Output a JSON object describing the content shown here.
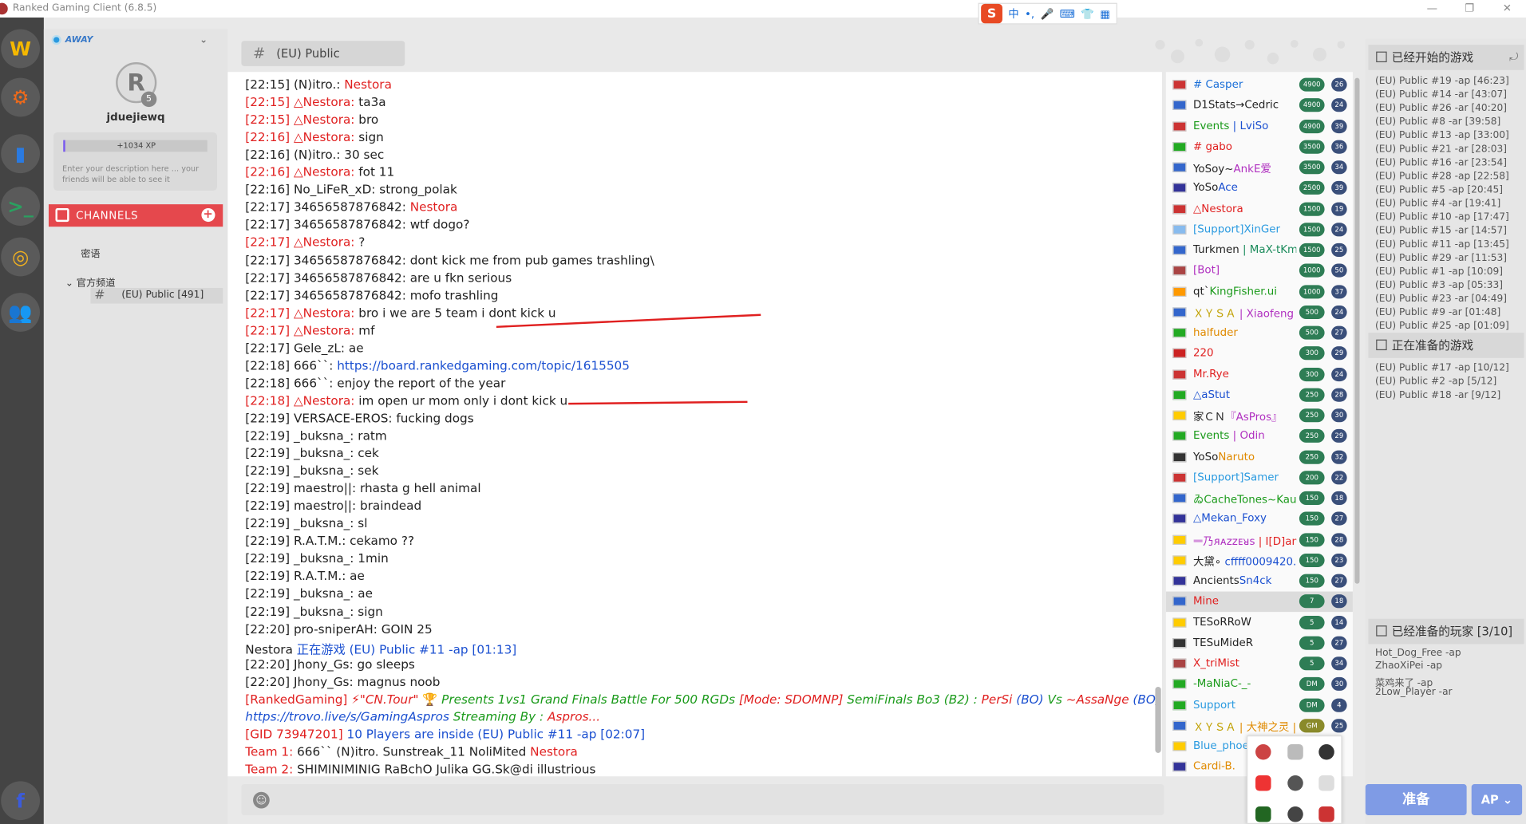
{
  "window": {
    "title": "Ranked Gaming Client (6.8.5)",
    "controls": [
      "—",
      "❐",
      "✕"
    ]
  },
  "ime": {
    "logo": "S",
    "items": [
      "中",
      "•,",
      "🎤",
      "⌨",
      "👕",
      "▦"
    ]
  },
  "strip": [
    {
      "name": "warcraft-icon",
      "glyph": "W",
      "color": "#f5b800"
    },
    {
      "name": "settings-icon",
      "glyph": "⚙",
      "color": "#f06a1a"
    },
    {
      "name": "stats-icon",
      "glyph": "▮",
      "color": "#2a7ae0"
    },
    {
      "name": "console-icon",
      "glyph": ">_",
      "color": "#2aa060"
    },
    {
      "name": "coins-icon",
      "glyph": "◎",
      "color": "#f0b020"
    },
    {
      "name": "friends-icon",
      "glyph": "👥",
      "color": "#e5484d"
    },
    {
      "name": "facebook-icon",
      "glyph": "f",
      "color": "#3b5bdb"
    }
  ],
  "profile": {
    "status": "AWAY",
    "username": "jduejiewq",
    "level": "5",
    "xp": "+1034 XP",
    "description": "Enter your description here ... your friends will be able to see it"
  },
  "channels": {
    "header": "CHANNELS",
    "items": [
      "密语",
      "官方频道",
      "(EU) Public [491]"
    ]
  },
  "chat_header": "(EU) Public",
  "messages": [
    {
      "segs": [
        {
          "t": "[22:15] ",
          "c": ""
        },
        {
          "t": "(N)itro.: ",
          "c": "b"
        },
        {
          "t": "Nestora",
          "c": "red"
        }
      ]
    },
    {
      "segs": [
        {
          "t": "[22:15] ",
          "c": "red"
        },
        {
          "t": "△Nestora: ",
          "c": "red b"
        },
        {
          "t": "ta3a",
          "c": ""
        }
      ]
    },
    {
      "segs": [
        {
          "t": "[22:15] ",
          "c": "red"
        },
        {
          "t": "△Nestora: ",
          "c": "red b"
        },
        {
          "t": "bro",
          "c": ""
        }
      ]
    },
    {
      "segs": [
        {
          "t": "[22:16] ",
          "c": "red"
        },
        {
          "t": "△Nestora: ",
          "c": "red b"
        },
        {
          "t": "sign",
          "c": ""
        }
      ]
    },
    {
      "segs": [
        {
          "t": "[22:16] ",
          "c": ""
        },
        {
          "t": "(N)itro.: ",
          "c": "b"
        },
        {
          "t": "30 sec",
          "c": ""
        }
      ]
    },
    {
      "segs": [
        {
          "t": "[22:16] ",
          "c": "red"
        },
        {
          "t": "△Nestora: ",
          "c": "red b"
        },
        {
          "t": "fot 11",
          "c": ""
        }
      ]
    },
    {
      "segs": [
        {
          "t": "[22:16] ",
          "c": ""
        },
        {
          "t": "No_LiFeR_xD: ",
          "c": "b"
        },
        {
          "t": "strong_polak",
          "c": ""
        }
      ]
    },
    {
      "segs": [
        {
          "t": "[22:17] ",
          "c": ""
        },
        {
          "t": "34656587876842: ",
          "c": "b"
        },
        {
          "t": "Nestora",
          "c": "red"
        }
      ]
    },
    {
      "segs": [
        {
          "t": "[22:17] ",
          "c": ""
        },
        {
          "t": "34656587876842: ",
          "c": "b"
        },
        {
          "t": "wtf dogo?",
          "c": ""
        }
      ]
    },
    {
      "segs": [
        {
          "t": "[22:17] ",
          "c": "red"
        },
        {
          "t": "△Nestora: ",
          "c": "red b"
        },
        {
          "t": "?",
          "c": ""
        }
      ]
    },
    {
      "segs": [
        {
          "t": "[22:17] ",
          "c": ""
        },
        {
          "t": "34656587876842: ",
          "c": "b"
        },
        {
          "t": "dont kick me from pub games trashling\\",
          "c": ""
        }
      ]
    },
    {
      "segs": [
        {
          "t": "[22:17] ",
          "c": ""
        },
        {
          "t": "34656587876842: ",
          "c": "b"
        },
        {
          "t": "are u fkn serious",
          "c": ""
        }
      ]
    },
    {
      "segs": [
        {
          "t": "[22:17] ",
          "c": ""
        },
        {
          "t": "34656587876842: ",
          "c": "b"
        },
        {
          "t": "mofo trashling",
          "c": ""
        }
      ]
    },
    {
      "segs": [
        {
          "t": "[22:17] ",
          "c": "red"
        },
        {
          "t": "△Nestora: ",
          "c": "red b"
        },
        {
          "t": "bro i we are 5 team i dont kick u",
          "c": ""
        }
      ]
    },
    {
      "segs": [
        {
          "t": "[22:17] ",
          "c": "red"
        },
        {
          "t": "△Nestora: ",
          "c": "red b"
        },
        {
          "t": "mf",
          "c": ""
        }
      ]
    },
    {
      "segs": [
        {
          "t": "[22:17] ",
          "c": ""
        },
        {
          "t": "Gele_zL: ",
          "c": "b"
        },
        {
          "t": "ae",
          "c": ""
        }
      ]
    },
    {
      "segs": [
        {
          "t": "[22:18] ",
          "c": ""
        },
        {
          "t": "666``: ",
          "c": "b"
        },
        {
          "t": "https://board.rankedgaming.com/topic/1615505",
          "c": "blue"
        }
      ]
    },
    {
      "segs": [
        {
          "t": "[22:18] ",
          "c": ""
        },
        {
          "t": "666``: ",
          "c": "b"
        },
        {
          "t": "enjoy the report of the year",
          "c": ""
        }
      ]
    },
    {
      "segs": [
        {
          "t": "[22:18] ",
          "c": "red"
        },
        {
          "t": "△Nestora: ",
          "c": "red b"
        },
        {
          "t": "im open ur mom only i dont kick u",
          "c": ""
        }
      ]
    },
    {
      "segs": [
        {
          "t": "[22:19] ",
          "c": ""
        },
        {
          "t": "VERSACE-EROS: ",
          "c": "b"
        },
        {
          "t": "fucking dogs",
          "c": ""
        }
      ]
    },
    {
      "segs": [
        {
          "t": "[22:19] ",
          "c": ""
        },
        {
          "t": "_buksna_: ",
          "c": "b"
        },
        {
          "t": "ratm",
          "c": ""
        }
      ]
    },
    {
      "segs": [
        {
          "t": "[22:19] ",
          "c": ""
        },
        {
          "t": "_buksna_: ",
          "c": "b"
        },
        {
          "t": "cek",
          "c": ""
        }
      ]
    },
    {
      "segs": [
        {
          "t": "[22:19] ",
          "c": ""
        },
        {
          "t": "_buksna_: ",
          "c": "b"
        },
        {
          "t": "sek",
          "c": ""
        }
      ]
    },
    {
      "segs": [
        {
          "t": "[22:19] ",
          "c": ""
        },
        {
          "t": "maestro||: ",
          "c": "b"
        },
        {
          "t": "rhasta g hell animal",
          "c": ""
        }
      ]
    },
    {
      "segs": [
        {
          "t": "[22:19] ",
          "c": ""
        },
        {
          "t": "maestro||: ",
          "c": "b"
        },
        {
          "t": "braindead",
          "c": ""
        }
      ]
    },
    {
      "segs": [
        {
          "t": "[22:19] ",
          "c": ""
        },
        {
          "t": "_buksna_: ",
          "c": "b"
        },
        {
          "t": "sl",
          "c": ""
        }
      ]
    },
    {
      "segs": [
        {
          "t": "[22:19] ",
          "c": ""
        },
        {
          "t": "R.A.T.M.: ",
          "c": "b"
        },
        {
          "t": "cekamo ??",
          "c": ""
        }
      ]
    },
    {
      "segs": [
        {
          "t": "[22:19] ",
          "c": ""
        },
        {
          "t": "_buksna_: ",
          "c": "b"
        },
        {
          "t": "1min",
          "c": ""
        }
      ]
    },
    {
      "segs": [
        {
          "t": "[22:19] ",
          "c": ""
        },
        {
          "t": "R.A.T.M.: ",
          "c": "b"
        },
        {
          "t": "ae",
          "c": ""
        }
      ]
    },
    {
      "segs": [
        {
          "t": "[22:19] ",
          "c": ""
        },
        {
          "t": "_buksna_: ",
          "c": "b"
        },
        {
          "t": "ae",
          "c": ""
        }
      ]
    },
    {
      "segs": [
        {
          "t": "[22:19] ",
          "c": ""
        },
        {
          "t": "_buksna_: ",
          "c": "b"
        },
        {
          "t": "sign",
          "c": ""
        }
      ]
    },
    {
      "segs": [
        {
          "t": "[22:20] ",
          "c": ""
        },
        {
          "t": "pro-sniperAH: ",
          "c": "b"
        },
        {
          "t": "GOIN 25",
          "c": ""
        }
      ]
    },
    {
      "segs": [
        {
          "t": "Nestora ",
          "c": "b"
        },
        {
          "t": "正在游戏 (EU) Public #11 -ap [01:13]",
          "c": "blue"
        }
      ]
    },
    {
      "segs": [
        {
          "t": "[22:20] ",
          "c": ""
        },
        {
          "t": "Jhony_Gs: ",
          "c": "b"
        },
        {
          "t": "go sleeps",
          "c": ""
        }
      ]
    },
    {
      "segs": [
        {
          "t": "[22:20] ",
          "c": ""
        },
        {
          "t": "Jhony_Gs: ",
          "c": "b"
        },
        {
          "t": "magnus noob",
          "c": ""
        }
      ]
    },
    {
      "segs": [
        {
          "t": "[RankedGaming] ",
          "c": "red"
        },
        {
          "t": "⚡\"CN.Tour\" ",
          "c": "red ital b"
        },
        {
          "t": "🏆 ",
          "c": "orange"
        },
        {
          "t": "Presents 1vs1 Grand Finals Battle For 500 RGDs ",
          "c": "green ital"
        },
        {
          "t": "[Mode: SDOMNP] ",
          "c": "red ital b"
        },
        {
          "t": "SemiFinals Bo3 (B2) : ",
          "c": "green ital"
        },
        {
          "t": "PerSi ",
          "c": "red ital b"
        },
        {
          "t": "(BO) ",
          "c": "blue ital b"
        },
        {
          "t": "Vs ",
          "c": "green ital b"
        },
        {
          "t": "~AssaNge ",
          "c": "red ital b"
        },
        {
          "t": "(BO)",
          "c": "blue ital b"
        }
      ]
    },
    {
      "segs": [
        {
          "t": "https://trovo.live/s/GamingAspros ",
          "c": "blue ital"
        },
        {
          "t": "Streaming By : ",
          "c": "green ital b"
        },
        {
          "t": "Aspros...",
          "c": "red ital b"
        }
      ]
    },
    {
      "segs": [
        {
          "t": "[GID 73947201] ",
          "c": "red"
        },
        {
          "t": "10 Players are inside (EU) Public #11 -ap [02:07]",
          "c": "blue"
        }
      ]
    },
    {
      "segs": [
        {
          "t": "Team 1:   ",
          "c": "red"
        },
        {
          "t": "666``   (N)itro.   Sunstreak_11   NoliMited   ",
          "c": "b"
        },
        {
          "t": "Nestora",
          "c": "red b"
        }
      ]
    },
    {
      "segs": [
        {
          "t": "Team 2:   ",
          "c": "red"
        },
        {
          "t": "SHIMINIMINIG   RaBchO   Julika   GG.Sk@di   illustrious",
          "c": "b"
        }
      ]
    }
  ],
  "users": [
    {
      "flag": "#c33",
      "segs": [
        {
          "t": "# Casper",
          "c": "#1a6fd8"
        }
      ],
      "elo": "4900",
      "lv": "26"
    },
    {
      "flag": "#36c",
      "segs": [
        {
          "t": "D1Stats→Cedric",
          "c": "#222"
        }
      ],
      "elo": "4900",
      "lv": "24"
    },
    {
      "flag": "#c33",
      "segs": [
        {
          "t": "Events",
          "c": "#1a9a1a"
        },
        {
          "t": " | LviSo",
          "c": "#1a4fd0"
        }
      ],
      "elo": "4900",
      "lv": "39"
    },
    {
      "flag": "#2a2",
      "segs": [
        {
          "t": "# gabo",
          "c": "#e02020"
        }
      ],
      "elo": "3500",
      "lv": "36"
    },
    {
      "flag": "#36c",
      "segs": [
        {
          "t": "YoSoy~",
          "c": "#222"
        },
        {
          "t": "AnkE爱",
          "c": "#b030c0"
        }
      ],
      "elo": "3500",
      "lv": "34"
    },
    {
      "flag": "#339",
      "segs": [
        {
          "t": "YoSo",
          "c": "#222"
        },
        {
          "t": "Ace",
          "c": "#1a4fd0"
        }
      ],
      "elo": "2500",
      "lv": "39"
    },
    {
      "flag": "#c33",
      "segs": [
        {
          "t": "△Nestora",
          "c": "#e02020"
        }
      ],
      "elo": "1500",
      "lv": "19"
    },
    {
      "flag": "#8be",
      "segs": [
        {
          "t": "[Support]XinGer",
          "c": "#2a9ae0"
        }
      ],
      "elo": "1500",
      "lv": "24"
    },
    {
      "flag": "#36c",
      "segs": [
        {
          "t": "Turkmen",
          "c": "#222"
        },
        {
          "t": " | MaX-tKm",
          "c": "#1a8a5a"
        }
      ],
      "elo": "1500",
      "lv": "25"
    },
    {
      "flag": "#a44",
      "segs": [
        {
          "t": "[Bot]",
          "c": "#b030c0"
        }
      ],
      "elo": "1000",
      "lv": "50"
    },
    {
      "flag": "#f90",
      "segs": [
        {
          "t": "qt`",
          "c": "#222"
        },
        {
          "t": "KingFisher.ui",
          "c": "#1a9a1a"
        }
      ],
      "elo": "1000",
      "lv": "37"
    },
    {
      "flag": "#36c",
      "segs": [
        {
          "t": "ＸＹＳＡ",
          "c": "#c0a000"
        },
        {
          "t": " | Xiaofeng | T",
          "c": "#b030c0"
        }
      ],
      "elo": "500",
      "lv": "24"
    },
    {
      "flag": "#2a2",
      "segs": [
        {
          "t": "halfuder",
          "c": "#e08a00"
        }
      ],
      "elo": "500",
      "lv": "27"
    },
    {
      "flag": "#c22",
      "segs": [
        {
          "t": "220",
          "c": "#e02020"
        }
      ],
      "elo": "300",
      "lv": "29"
    },
    {
      "flag": "#c33",
      "segs": [
        {
          "t": "Mr.Rye",
          "c": "#e02020"
        }
      ],
      "elo": "300",
      "lv": "24"
    },
    {
      "flag": "#2a2",
      "segs": [
        {
          "t": "△aStut",
          "c": "#1a4fd0"
        }
      ],
      "elo": "250",
      "lv": "28"
    },
    {
      "flag": "#fc0",
      "segs": [
        {
          "t": "家ＣＮ",
          "c": "#222"
        },
        {
          "t": "『AsPros』",
          "c": "#b030c0"
        }
      ],
      "elo": "250",
      "lv": "30"
    },
    {
      "flag": "#2a2",
      "segs": [
        {
          "t": "Events",
          "c": "#1a9a1a"
        },
        {
          "t": " | Odin",
          "c": "#b030c0"
        }
      ],
      "elo": "250",
      "lv": "29"
    },
    {
      "flag": "#333",
      "segs": [
        {
          "t": "YoSo",
          "c": "#222"
        },
        {
          "t": "Naruto",
          "c": "#e08a00"
        }
      ],
      "elo": "250",
      "lv": "32"
    },
    {
      "flag": "#c33",
      "segs": [
        {
          "t": "[Support]Samer",
          "c": "#2a9ae0"
        }
      ],
      "elo": "200",
      "lv": "22"
    },
    {
      "flag": "#36c",
      "segs": [
        {
          "t": "ゐCacheTones~Kauu»",
          "c": "#1a9a1a"
        }
      ],
      "elo": "150",
      "lv": "18"
    },
    {
      "flag": "#339",
      "segs": [
        {
          "t": "△Mekan_Foxy",
          "c": "#1a4fd0"
        }
      ],
      "elo": "150",
      "lv": "27"
    },
    {
      "flag": "#fc0",
      "segs": [
        {
          "t": "ᆖ乃ᴙᴀzzᴇᴚs",
          "c": "#b030c0"
        },
        {
          "t": " | I[D]anil",
          "c": "#e02020"
        }
      ],
      "elo": "150",
      "lv": "28"
    },
    {
      "flag": "#fc0",
      "segs": [
        {
          "t": "大黛∘",
          "c": "#222"
        },
        {
          "t": " cffff0009420.",
          "c": "#1a4fd0"
        }
      ],
      "elo": "150",
      "lv": "23"
    },
    {
      "flag": "#339",
      "segs": [
        {
          "t": "Ancients",
          "c": "#222"
        },
        {
          "t": "Sn4ck",
          "c": "#1a4fd0"
        }
      ],
      "elo": "150",
      "lv": "27"
    },
    {
      "flag": "#36c",
      "segs": [
        {
          "t": "Mine",
          "c": "#e02020"
        }
      ],
      "elo": "7",
      "lv": "18",
      "sel": true
    },
    {
      "flag": "#fc0",
      "segs": [
        {
          "t": "TESoRRoW",
          "c": "#222"
        }
      ],
      "elo": "5",
      "lv": "14"
    },
    {
      "flag": "#333",
      "segs": [
        {
          "t": "TESuMideR",
          "c": "#222"
        }
      ],
      "elo": "5",
      "lv": "27"
    },
    {
      "flag": "#a44",
      "segs": [
        {
          "t": "X_triMist",
          "c": "#e02020"
        }
      ],
      "elo": "5",
      "lv": "34"
    },
    {
      "flag": "#2a2",
      "segs": [
        {
          "t": "-MaNiaC-_-",
          "c": "#1a9a1a"
        }
      ],
      "elo": "DM",
      "lv": "30"
    },
    {
      "flag": "#2a2",
      "segs": [
        {
          "t": "Support",
          "c": "#2a9ae0"
        }
      ],
      "elo": "DM",
      "lv": "4"
    },
    {
      "flag": "#36c",
      "segs": [
        {
          "t": "ＸＹＳＡ",
          "c": "#c0a000"
        },
        {
          "t": " | 大神之灵 | T",
          "c": "#e08a00"
        }
      ],
      "elo": "GM",
      "lv": "25"
    },
    {
      "flag": "#fc0",
      "segs": [
        {
          "t": "Blue_phoe",
          "c": "#2a9ae0"
        }
      ],
      "elo": "",
      "lv": ""
    },
    {
      "flag": "#339",
      "segs": [
        {
          "t": "Cardi-B.",
          "c": "#e08a00"
        }
      ],
      "elo": "",
      "lv": ""
    }
  ],
  "started_games": {
    "title": "已经开始的游戏",
    "items": [
      "(EU) Public #19 -ap [46:23]",
      "(EU) Public #14 -ar [43:07]",
      "(EU) Public #26 -ar [40:20]",
      "(EU) Public #8 -ar [39:58]",
      "(EU) Public #13 -ap [33:00]",
      "(EU) Public #21 -ar [28:03]",
      "(EU) Public #16 -ar [23:54]",
      "(EU) Public #28 -ap [22:58]",
      "(EU) Public #5 -ap [20:45]",
      "(EU) Public #4 -ar [19:41]",
      "(EU) Public #10 -ap [17:47]",
      "(EU) Public #15 -ar [14:57]",
      "(EU) Public #11 -ap [13:45]",
      "(EU) Public #29 -ar [11:53]",
      "(EU) Public #1 -ap [10:09]",
      "(EU) Public #3 -ap [05:33]",
      "(EU) Public #23 -ar [04:49]",
      "(EU) Public #9 -ar [01:48]",
      "(EU) Public #25 -ap [01:09]"
    ]
  },
  "preparing_games": {
    "title": "正在准备的游戏",
    "items": [
      "(EU) Public #17 -ap [10/12]",
      "(EU) Public #2 -ap [5/12]",
      "(EU) Public #18 -ar [9/12]"
    ]
  },
  "ready_players": {
    "title": "已经准备的玩家 [3/10]",
    "items": [
      "Hot_Dog_Free -ap",
      "ZhaoXiPei -ap",
      "菜鸡来了 -ap",
      "2Low_Player -ar"
    ]
  },
  "buttons": {
    "ready": "准备",
    "mode": "AP"
  }
}
